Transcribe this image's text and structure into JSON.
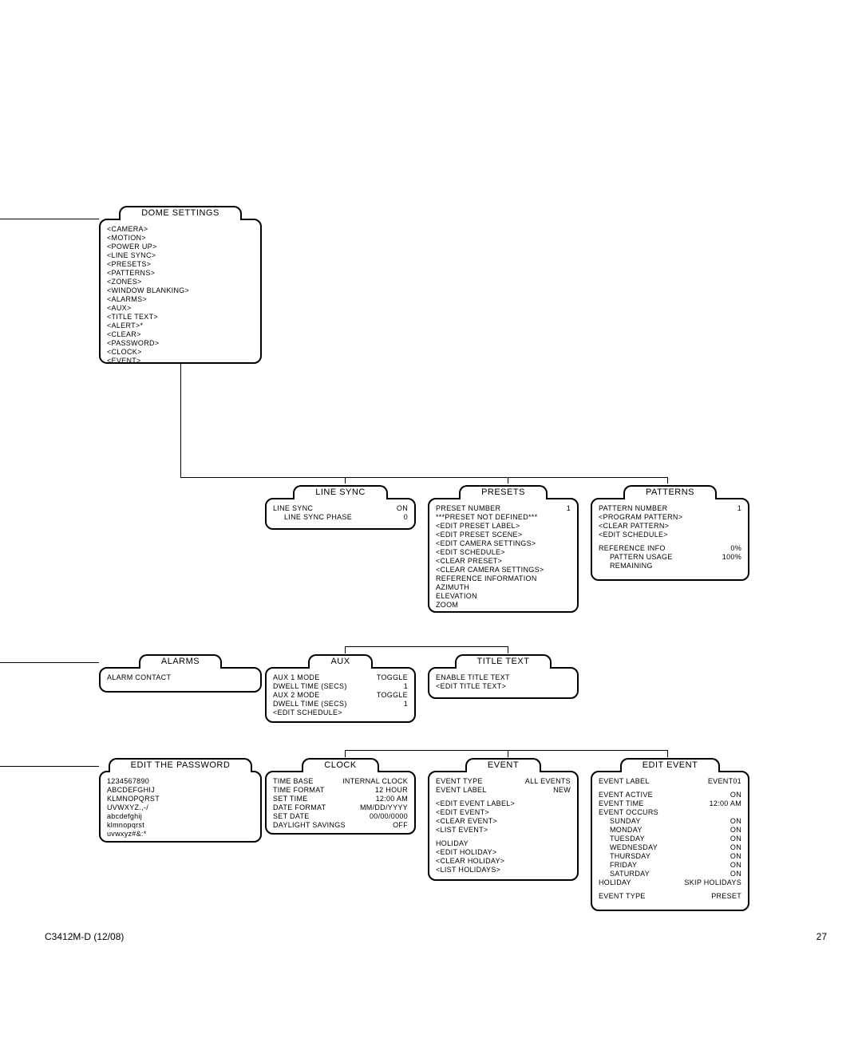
{
  "footer": {
    "left": "C3412M-D (12/08)",
    "right": "27"
  },
  "dome": {
    "title": "DOME SETTINGS",
    "items": [
      "<CAMERA>",
      "<MOTION>",
      "<POWER UP>",
      "<LINE SYNC>",
      "<PRESETS>",
      "<PATTERNS>",
      "<ZONES>",
      "<WINDOW BLANKING>",
      "<ALARMS>",
      "<AUX>",
      "<TITLE TEXT>",
      "<ALERT>*",
      "<CLEAR>",
      "<PASSWORD>",
      "<CLOCK>",
      "<EVENT>"
    ]
  },
  "linesync": {
    "title": "LINE SYNC",
    "l0": "LINE SYNC",
    "v0": "ON",
    "l1": "LINE SYNC PHASE",
    "v1": "0"
  },
  "presets": {
    "title": "PRESETS",
    "l0": "PRESET NUMBER",
    "v0": "1",
    "l1": "***PRESET NOT DEFINED***",
    "l2": "<EDIT PRESET LABEL>",
    "l3": "<EDIT PRESET SCENE>",
    "l4": "<EDIT CAMERA SETTINGS>",
    "l5": "<EDIT SCHEDULE>",
    "l6": "<CLEAR PRESET>",
    "l7": "<CLEAR CAMERA SETTINGS>",
    "l8": "REFERENCE INFORMATION",
    "l9": "AZIMUTH",
    "l10": "ELEVATION",
    "l11": "ZOOM"
  },
  "patterns": {
    "title": "PATTERNS",
    "l0": "PATTERN NUMBER",
    "v0": "1",
    "l1": "<PROGRAM PATTERN>",
    "l2": "<CLEAR PATTERN>",
    "l3": "<EDIT SCHEDULE>",
    "l4": "REFERENCE INFO",
    "v4": "0%",
    "l5": "PATTERN USAGE",
    "v5": "100%",
    "l6": "REMAINING"
  },
  "alarms": {
    "title": "ALARMS",
    "l0": "ALARM CONTACT"
  },
  "aux": {
    "title": "AUX",
    "l0": "AUX 1 MODE",
    "v0": "TOGGLE",
    "l1": "DWELL TIME (SECS)",
    "v1": "1",
    "l2": "AUX 2 MODE",
    "v2": "TOGGLE",
    "l3": "DWELL TIME (SECS)",
    "v3": "1",
    "l4": "<EDIT SCHEDULE>"
  },
  "title_text": {
    "title": "TITLE TEXT",
    "l0": "ENABLE TITLE TEXT",
    "l1": "<EDIT TITLE TEXT>"
  },
  "password": {
    "title": "EDIT THE PASSWORD",
    "l0": "1234567890",
    "l1": "ABCDEFGHIJ",
    "l2": "KLMNOPQRST",
    "l3": "UVWXYZ.,-/",
    "l4": "abcdefghij",
    "l5": "klmnopqrst",
    "l6": "uvwxyz#&:*"
  },
  "clock": {
    "title": "CLOCK",
    "l0": "TIME BASE",
    "v0": "INTERNAL CLOCK",
    "l1": "TIME FORMAT",
    "v1": "12 HOUR",
    "l2": "SET TIME",
    "v2": "12:00 AM",
    "l3": "DATE FORMAT",
    "v3": "MM/DD/YYYY",
    "l4": "SET DATE",
    "v4": "00/00/0000",
    "l5": "DAYLIGHT SAVINGS",
    "v5": "OFF"
  },
  "event": {
    "title": "EVENT",
    "l0": "EVENT TYPE",
    "v0": "ALL EVENTS",
    "l1": "EVENT LABEL",
    "v1": "NEW",
    "l2": "<EDIT EVENT LABEL>",
    "l3": "<EDIT EVENT>",
    "l4": "<CLEAR EVENT>",
    "l5": "<LIST EVENT>",
    "l6": "HOLIDAY",
    "l7": "<EDIT HOLIDAY>",
    "l8": "<CLEAR HOLIDAY>",
    "l9": "<LIST HOLIDAYS>"
  },
  "edit_event": {
    "title": "EDIT EVENT",
    "l0": "EVENT LABEL",
    "v0": "EVENT01",
    "l1": "EVENT ACTIVE",
    "v1": "ON",
    "l2": "EVENT TIME",
    "v2": "12:00 AM",
    "l3": "EVENT OCCURS",
    "d0": "SUNDAY",
    "dv0": "ON",
    "d1": "MONDAY",
    "dv1": "ON",
    "d2": "TUESDAY",
    "dv2": "ON",
    "d3": "WEDNESDAY",
    "dv3": "ON",
    "d4": "THURSDAY",
    "dv4": "ON",
    "d5": "FRIDAY",
    "dv5": "ON",
    "d6": "SATURDAY",
    "dv6": "ON",
    "l4": "HOLIDAY",
    "v4": "SKIP HOLIDAYS",
    "l5": "EVENT TYPE",
    "v5": "PRESET"
  }
}
